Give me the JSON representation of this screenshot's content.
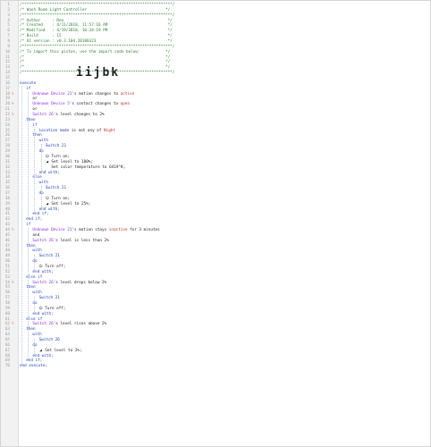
{
  "editor": {
    "import_code": "iijbk",
    "lines": [
      {
        "n": "1",
        "text": "/*****************************************************************/",
        "type": "cmt"
      },
      {
        "n": "2",
        "text": "/* Wash Room Light Controller                                  */",
        "type": "cmt"
      },
      {
        "n": "3",
        "text": "/*****************************************************************/",
        "type": "cmt"
      },
      {
        "n": "4",
        "text": "/* Author     : Reo                                             */",
        "type": "cmt"
      },
      {
        "n": "5",
        "text": "/* Created    : 4/11/2018, 11:57:16 AM                          */",
        "type": "cmt"
      },
      {
        "n": "6",
        "text": "/* Modified   : 4/19/2018, 10:34:19 PM                          */",
        "type": "cmt"
      },
      {
        "n": "7",
        "text": "/* Build      : 15                                              */",
        "type": "cmt"
      },
      {
        "n": "8",
        "text": "/* UI version : v0.3.104.20180323                               */",
        "type": "cmt"
      },
      {
        "n": "9",
        "text": "/*****************************************************************/",
        "type": "cmt"
      },
      {
        "n": "10",
        "text": "/* To import this piston, use the import code below:           */",
        "type": "cmt"
      },
      {
        "n": "11",
        "text": "/*                                                             */",
        "type": "cmt"
      },
      {
        "n": "12",
        "text": "/*                                                             */",
        "type": "cmt"
      },
      {
        "n": "13",
        "text": "/*                                                             */",
        "type": "cmt"
      },
      {
        "n": "14",
        "text": "/*****************************************************************/",
        "type": "cmt"
      },
      {
        "n": "15",
        "text": "",
        "type": "blank"
      },
      {
        "n": "16",
        "text": "execute",
        "type": "kw",
        "indent": 0
      },
      {
        "n": "17",
        "text": "if",
        "type": "kw",
        "indent": 1
      },
      {
        "n": "18",
        "type": "cond",
        "indent": 2,
        "mark": true,
        "dev": "Unknown Device 21",
        "mid": "'s motion changes to ",
        "val": "active"
      },
      {
        "n": "19",
        "text": "or",
        "type": "plain",
        "indent": 2
      },
      {
        "n": "20",
        "type": "cond",
        "indent": 2,
        "mark": true,
        "dev": "Unknown Device 5",
        "mid": "'s contact changes to ",
        "val": "open"
      },
      {
        "n": "21",
        "text": "or",
        "type": "plain",
        "indent": 2
      },
      {
        "n": "22",
        "type": "cond",
        "indent": 2,
        "mark": true,
        "dev": "Switch 26",
        "mid": "'s level changes to ",
        "val": "2%",
        "valplain": true
      },
      {
        "n": "23",
        "text": "then",
        "type": "kw",
        "indent": 1
      },
      {
        "n": "24",
        "text": "if",
        "type": "kw",
        "indent": 2
      },
      {
        "n": "25",
        "type": "cond",
        "indent": 3,
        "dev": "Location mode",
        "mid": " is not any of ",
        "val": "Night"
      },
      {
        "n": "26",
        "text": "then",
        "type": "kw",
        "indent": 2
      },
      {
        "n": "27",
        "text": "with",
        "type": "kw",
        "indent": 3
      },
      {
        "n": "28",
        "type": "dev",
        "indent": 4,
        "dev": "Switch 21"
      },
      {
        "n": "29",
        "text": "do",
        "type": "kw",
        "indent": 3
      },
      {
        "n": "30",
        "type": "act",
        "indent": 4,
        "icon": "⏻",
        "text": "Turn on;"
      },
      {
        "n": "31",
        "type": "act",
        "indent": 4,
        "icon": "◢",
        "text": "Set level to 100%;"
      },
      {
        "n": "32",
        "type": "act",
        "indent": 4,
        "icon": "",
        "text": "Set color temperature to 6419°K;"
      },
      {
        "n": "33",
        "text": "end with;",
        "type": "kw",
        "indent": 3
      },
      {
        "n": "34",
        "text": "else",
        "type": "kw",
        "indent": 2
      },
      {
        "n": "35",
        "text": "with",
        "type": "kw",
        "indent": 3
      },
      {
        "n": "36",
        "type": "dev",
        "indent": 4,
        "dev": "Switch 21"
      },
      {
        "n": "37",
        "text": "do",
        "type": "kw",
        "indent": 3
      },
      {
        "n": "38",
        "type": "act",
        "indent": 4,
        "icon": "⏻",
        "text": "Turn on;"
      },
      {
        "n": "39",
        "type": "act",
        "indent": 4,
        "icon": "◢",
        "text": "Set level to 25%;"
      },
      {
        "n": "40",
        "text": "end with;",
        "type": "kw",
        "indent": 3
      },
      {
        "n": "41",
        "text": "end if;",
        "type": "kw",
        "indent": 2
      },
      {
        "n": "42",
        "text": "end if;",
        "type": "kw",
        "indent": 1
      },
      {
        "n": "43",
        "text": "if",
        "type": "kw",
        "indent": 1
      },
      {
        "n": "44",
        "type": "cond3",
        "indent": 2,
        "mark": true,
        "dev": "Unknown Device 21",
        "mid": "'s motion stays ",
        "val": "inactive",
        "tail": " for 3 minutes"
      },
      {
        "n": "45",
        "text": "and",
        "type": "plain",
        "indent": 2
      },
      {
        "n": "46",
        "type": "cond",
        "indent": 2,
        "dev": "Switch 26",
        "mid": "'s level is less than ",
        "val": "2%",
        "valplain": true
      },
      {
        "n": "47",
        "text": "then",
        "type": "kw",
        "indent": 1
      },
      {
        "n": "48",
        "text": "with",
        "type": "kw",
        "indent": 2
      },
      {
        "n": "49",
        "type": "dev",
        "indent": 3,
        "dev": "Switch 21"
      },
      {
        "n": "50",
        "text": "do",
        "type": "kw",
        "indent": 2
      },
      {
        "n": "51",
        "type": "act",
        "indent": 3,
        "icon": "⏻",
        "text": "Turn off;"
      },
      {
        "n": "52",
        "text": "end with;",
        "type": "kw",
        "indent": 2
      },
      {
        "n": "53",
        "text": "else if",
        "type": "kw",
        "indent": 1
      },
      {
        "n": "54",
        "type": "cond",
        "indent": 2,
        "mark": true,
        "dev": "Switch 26",
        "mid": "'s level drops below ",
        "val": "2%",
        "valplain": true
      },
      {
        "n": "55",
        "text": "then",
        "type": "kw",
        "indent": 1
      },
      {
        "n": "56",
        "text": "with",
        "type": "kw",
        "indent": 2
      },
      {
        "n": "57",
        "type": "dev",
        "indent": 3,
        "dev": "Switch 21"
      },
      {
        "n": "58",
        "text": "do",
        "type": "kw",
        "indent": 2
      },
      {
        "n": "59",
        "type": "act",
        "indent": 3,
        "icon": "⏻",
        "text": "Turn off;"
      },
      {
        "n": "60",
        "text": "end with;",
        "type": "kw",
        "indent": 2
      },
      {
        "n": "61",
        "text": "else if",
        "type": "kw",
        "indent": 1
      },
      {
        "n": "62",
        "type": "cond",
        "indent": 2,
        "mark": true,
        "dev": "Switch 26",
        "mid": "'s level rises above ",
        "val": "2%",
        "valplain": true
      },
      {
        "n": "63",
        "text": "then",
        "type": "kw",
        "indent": 1
      },
      {
        "n": "64",
        "text": "with",
        "type": "kw",
        "indent": 2
      },
      {
        "n": "65",
        "type": "dev",
        "indent": 3,
        "dev": "Switch 26"
      },
      {
        "n": "66",
        "text": "do",
        "type": "kw",
        "indent": 2
      },
      {
        "n": "67",
        "type": "act",
        "indent": 3,
        "icon": "◢",
        "text": "Set level to 2%;"
      },
      {
        "n": "68",
        "text": "end with;",
        "type": "kw",
        "indent": 2
      },
      {
        "n": "69",
        "text": "end if;",
        "type": "kw",
        "indent": 1
      },
      {
        "n": "70",
        "text": "end execute;",
        "type": "kw",
        "indent": 0
      }
    ]
  },
  "colors": {
    "comment": "#2e7d32",
    "keyword": "#1f3fb3",
    "device": "#8a2be2",
    "value": "#c62828",
    "marker": "#e8734a"
  },
  "icons": {
    "trigger_marker": "lightning-icon",
    "turn_on_off": "power-icon",
    "set_level": "level-icon"
  }
}
